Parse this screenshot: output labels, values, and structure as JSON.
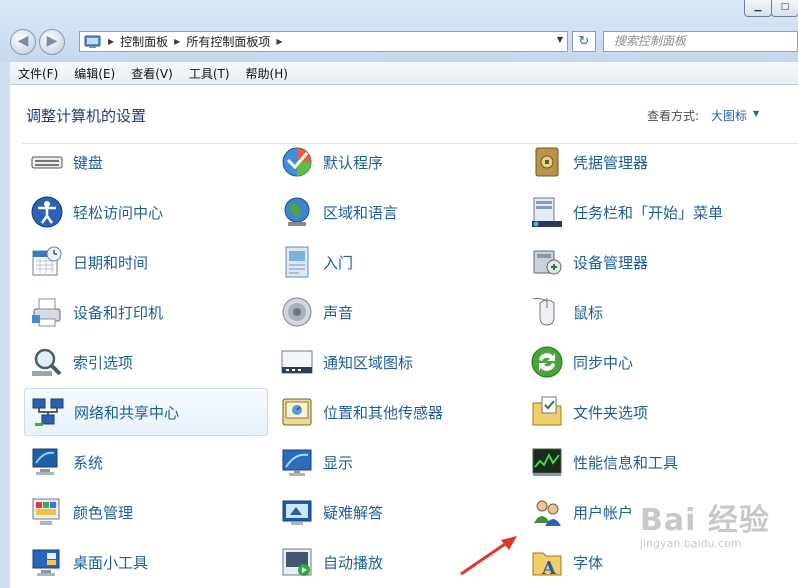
{
  "titlebar": {
    "minimize_glyph": "▁",
    "maximize_glyph": "□"
  },
  "address": {
    "crumbs": [
      "控制面板",
      "所有控制面板项"
    ]
  },
  "search": {
    "placeholder": "搜索控制面板"
  },
  "menu": [
    "文件(F)",
    "编辑(E)",
    "查看(V)",
    "工具(T)",
    "帮助(H)"
  ],
  "header": {
    "title": "调整计算机的设置",
    "view_label": "查看方式:",
    "view_value": "大图标"
  },
  "items": [
    {
      "label": "键盘",
      "icon": "keyboard-icon"
    },
    {
      "label": "默认程序",
      "icon": "default-programs-icon"
    },
    {
      "label": "凭据管理器",
      "icon": "credential-vault-icon"
    },
    {
      "label": "轻松访问中心",
      "icon": "ease-of-access-icon"
    },
    {
      "label": "区域和语言",
      "icon": "globe-icon"
    },
    {
      "label": "任务栏和「开始」菜单",
      "icon": "taskbar-icon"
    },
    {
      "label": "日期和时间",
      "icon": "calendar-clock-icon"
    },
    {
      "label": "入门",
      "icon": "getting-started-icon"
    },
    {
      "label": "设备管理器",
      "icon": "device-manager-icon"
    },
    {
      "label": "设备和打印机",
      "icon": "printer-icon"
    },
    {
      "label": "声音",
      "icon": "speaker-icon"
    },
    {
      "label": "鼠标",
      "icon": "mouse-icon"
    },
    {
      "label": "索引选项",
      "icon": "magnifier-icon"
    },
    {
      "label": "通知区域图标",
      "icon": "notification-area-icon"
    },
    {
      "label": "同步中心",
      "icon": "sync-icon"
    },
    {
      "label": "网络和共享中心",
      "icon": "network-icon"
    },
    {
      "label": "位置和其他传感器",
      "icon": "sensor-icon"
    },
    {
      "label": "文件夹选项",
      "icon": "folder-options-icon"
    },
    {
      "label": "系统",
      "icon": "system-icon"
    },
    {
      "label": "显示",
      "icon": "display-icon"
    },
    {
      "label": "性能信息和工具",
      "icon": "performance-icon"
    },
    {
      "label": "颜色管理",
      "icon": "color-management-icon"
    },
    {
      "label": "疑难解答",
      "icon": "troubleshooting-icon"
    },
    {
      "label": "用户帐户",
      "icon": "user-accounts-icon"
    },
    {
      "label": "桌面小工具",
      "icon": "gadgets-icon"
    },
    {
      "label": "自动播放",
      "icon": "autoplay-icon"
    },
    {
      "label": "字体",
      "icon": "fonts-icon"
    }
  ],
  "selected_item": "网络和共享中心",
  "watermark": {
    "logo": "Bai 经验",
    "url": "jingyan.baidu.com"
  },
  "colors": {
    "link": "#1d5d9a",
    "title": "#1e3f7a",
    "accent": "#1f5fb3",
    "arrow": "#e0352b"
  }
}
